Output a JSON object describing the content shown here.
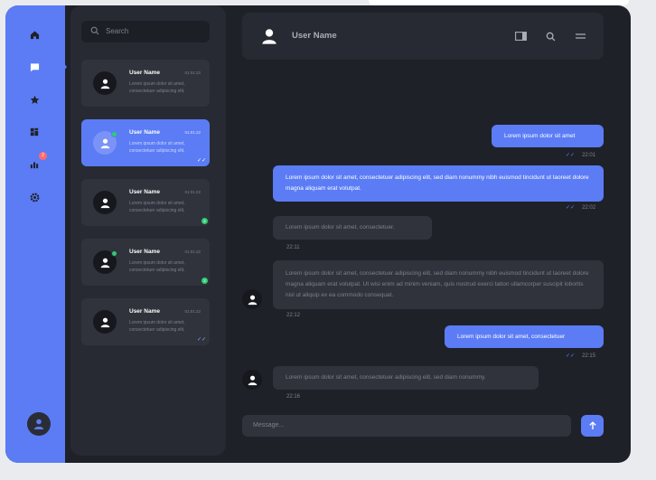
{
  "colors": {
    "accent": "#5b7cf5",
    "online": "#2ecc71",
    "badge": "#ff6b6b"
  },
  "rail": {
    "items": [
      {
        "icon": "home-icon"
      },
      {
        "icon": "chat-icon"
      },
      {
        "icon": "star-icon"
      },
      {
        "icon": "dashboard-icon"
      },
      {
        "icon": "stats-icon",
        "badge": "2"
      },
      {
        "icon": "settings-icon"
      }
    ]
  },
  "search": {
    "placeholder": "Search"
  },
  "chats": [
    {
      "name": "User Name",
      "time": "01:01:22",
      "preview": "Lorem ipsum dolor sit amet, consectetuer adipiscing elit,"
    },
    {
      "name": "User Name",
      "time": "01:01:22",
      "preview": "Lorem ipsum dolor sit amet, consectetuer adipiscing elit,"
    },
    {
      "name": "User Name",
      "time": "01:01:22",
      "preview": "Lorem ipsum dolor sit amet, consectetuer adipiscing elit,",
      "unread": "2"
    },
    {
      "name": "User Name",
      "time": "01:01:22",
      "preview": "Lorem ipsum dolor sit amet, consectetuer adipiscing elit,",
      "unread": "2"
    },
    {
      "name": "User Name",
      "time": "01:01:22",
      "preview": "Lorem ipsum dolor sit amet, consectetuer adipiscing elit,"
    }
  ],
  "header": {
    "name": "User Name"
  },
  "messages": [
    {
      "text": "Lorem ipsum dolor sit amet",
      "time": "22:01",
      "direction": "out"
    },
    {
      "text": "Lorem ipsum dolor sit amet, consectetuer adipiscing elit, sed diam nonummy nibh euismod tincidunt ut laoreet dolore magna aliquam erat volutpat.",
      "time": "22:02",
      "direction": "out"
    },
    {
      "text": "Lorem ipsum dolor sit amet, consectetuer.",
      "time": "22:11",
      "direction": "in"
    },
    {
      "text": "Lorem ipsum dolor sit amet, consectetuer adipiscing elit, sed diam nonummy nibh euismod tincidunt ut laoreet dolore magna aliquam erat volutpat. Ut wisi enim ad minim veniam, quis nostrud exerci tation ullamcorper suscipit lobortis nisl ut aliquip ex ea commodo consequat.",
      "time": "22:12",
      "direction": "in"
    },
    {
      "text": "Lorem ipsum dolor sit amet, consectetuer",
      "time": "22:15",
      "direction": "out"
    },
    {
      "text": "Lorem ipsum dolor sit amet, consectetuer adipiscing elit, sed diam nonummy.",
      "time": "22:16",
      "direction": "in"
    }
  ],
  "composer": {
    "placeholder": "Message..."
  }
}
